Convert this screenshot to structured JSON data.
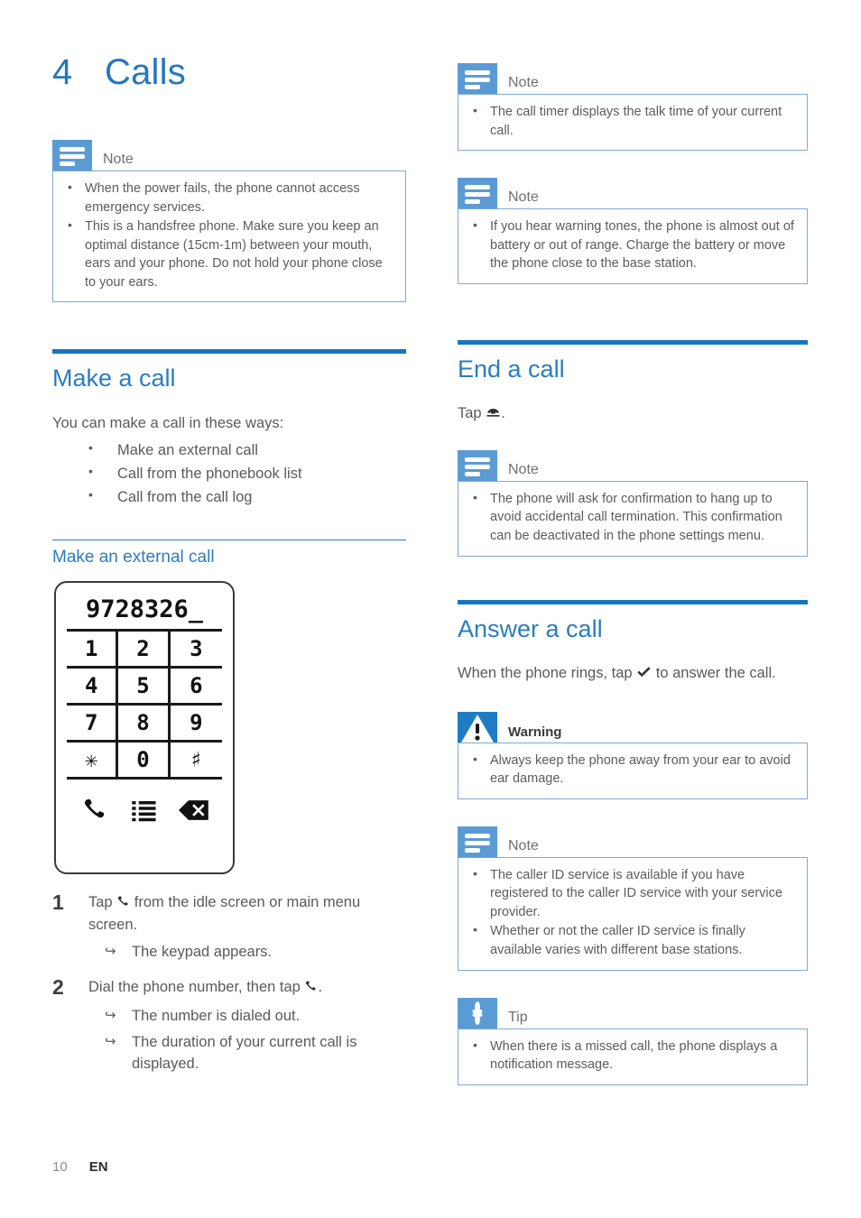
{
  "chapter": {
    "number": "4",
    "title": "Calls"
  },
  "colors": {
    "heading_blue": "#2a7cc0",
    "rule_blue": "#1477be",
    "note_icon_blue": "#5b9bd5",
    "warning_icon_blue": "#1f7cc4",
    "box_border": "#7fa9d4"
  },
  "left_column": {
    "note_top": {
      "label": "Note",
      "icon": "note-icon",
      "items": [
        "When the power fails, the phone cannot access emergency services.",
        "This is a handsfree phone. Make sure you keep an optimal distance (15cm-1m) between your mouth, ears and your phone. Do not hold your phone close to your ears."
      ]
    },
    "make_a_call": {
      "heading": "Make a call",
      "intro": "You can make a call in these ways:",
      "ways": [
        "Make an external call",
        "Call from the phonebook list",
        "Call from the call log"
      ]
    },
    "make_external_call": {
      "heading": "Make an external call",
      "keypad": {
        "display": "9728326_",
        "rows": [
          [
            "1",
            "2",
            "3"
          ],
          [
            "4",
            "5",
            "6"
          ],
          [
            "7",
            "8",
            "9"
          ],
          [
            "✳",
            "0",
            "♯"
          ]
        ],
        "actions": [
          "call-icon",
          "phonebook-list-icon",
          "backspace-icon"
        ]
      },
      "steps": [
        {
          "number": "1",
          "text_before": "Tap",
          "icon": "call-handset-icon",
          "text_after": "from the idle screen or main menu screen.",
          "results": [
            "The keypad appears."
          ]
        },
        {
          "number": "2",
          "text_before": "Dial the phone number, then tap",
          "icon": "call-handset-icon",
          "text_after": ".",
          "results": [
            "The number is dialed out.",
            "The duration of your current call is displayed."
          ]
        }
      ]
    }
  },
  "right_column": {
    "note_call_timer": {
      "label": "Note",
      "icon": "note-icon",
      "items": [
        "The call timer displays the talk time of your current call."
      ]
    },
    "note_warning_tones": {
      "label": "Note",
      "icon": "note-icon",
      "items": [
        "If you hear warning tones, the phone is almost out of battery or out of range. Charge the battery or move the phone close to the base station."
      ]
    },
    "end_a_call": {
      "heading": "End a call",
      "text_before": "Tap",
      "icon": "end-call-icon",
      "text_after": ".",
      "note": {
        "label": "Note",
        "icon": "note-icon",
        "items": [
          "The phone will ask for confirmation to hang up to avoid accidental call termination. This confirmation can be deactivated in the phone settings menu."
        ]
      }
    },
    "answer_a_call": {
      "heading": "Answer a call",
      "text_before": "When the phone rings, tap",
      "icon": "checkmark-icon",
      "text_after": "to answer the call.",
      "warning": {
        "label": "Warning",
        "icon": "warning-icon",
        "items": [
          "Always keep the phone away from your ear to avoid ear damage."
        ]
      },
      "note": {
        "label": "Note",
        "icon": "note-icon",
        "items": [
          "The caller ID service is available if you have registered to the caller ID service with your service provider.",
          "Whether or not the caller ID service is finally available varies with different base stations."
        ]
      },
      "tip": {
        "label": "Tip",
        "icon": "tip-icon",
        "items": [
          "When there is a missed call, the phone displays a notification message."
        ]
      }
    }
  },
  "footer": {
    "page_number": "10",
    "language": "EN"
  }
}
